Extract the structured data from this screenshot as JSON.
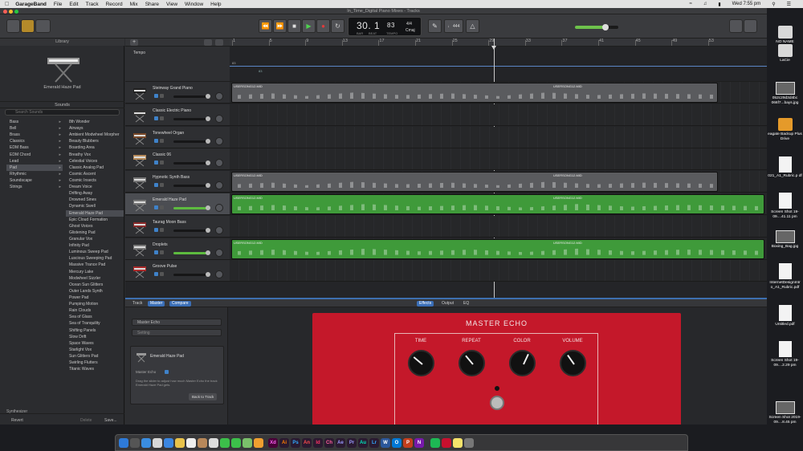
{
  "menubar": {
    "app": "GarageBand",
    "items": [
      "File",
      "Edit",
      "Track",
      "Record",
      "Mix",
      "Share",
      "View",
      "Window",
      "Help"
    ],
    "clock": "Wed 7:55 pm"
  },
  "window": {
    "title": "In_Time_Digital Piano Mixes - Tracks"
  },
  "lcd": {
    "position": "30. 1",
    "bar_lbl": "BAR",
    "beat_lbl": "BEAT",
    "tempo": "83",
    "tempo_lbl": "TEMPO",
    "sig": "4/4",
    "key": "Cmaj",
    "count": "♩ 444"
  },
  "library": {
    "header": "Library",
    "selected_patch": "Emerald Haze Pad",
    "sounds_header": "Sounds",
    "search_placeholder": "Search Sounds",
    "categories": [
      "Bass",
      "Bell",
      "Brass",
      "Classics",
      "EDM Bass",
      "EDM Chord",
      "Lead",
      "Pad",
      "Rhythmic",
      "Soundscape",
      "Strings"
    ],
    "selected_category": 7,
    "sounds": [
      "8th Wonder",
      "Airways",
      "Ambient Modwheel Morpher",
      "Beauty Blubbers",
      "Boarding Area",
      "Breathy Vox",
      "Celestial Voices",
      "Classic Analog Pad",
      "Cosmic Ascent",
      "Cosmic Insects",
      "Dream Voice",
      "Drifting Away",
      "Drowned Sines",
      "Dynamic Swell",
      "Emerald Haze Pad",
      "Epic Cloud Formation",
      "Ghost Voices",
      "Glistening Pad",
      "Granular Vox",
      "Infinity Pad",
      "Luminous Sweep Pad",
      "Luscious Sweeping Pad",
      "Massive Trance Pad",
      "Mercury Lake",
      "Modwheel Sizzler",
      "Ocean Sun Glitters",
      "Outer Lands Synth",
      "Power Pad",
      "Pumping Motion",
      "Rain Clouds",
      "Sea of Glass",
      "Sea of Tranquility",
      "Shifting Panels",
      "Slow Drift",
      "Space Waves",
      "Starlight Vox",
      "Sun Glitters Pad",
      "Swirling Flutters",
      "Titanic Waves"
    ],
    "selected_sound": 14,
    "synthesizer": "Synthesizer",
    "revert": "Revert",
    "delete": "Delete",
    "save": "Save..."
  },
  "ruler": [
    "1",
    "5",
    "9",
    "13",
    "17",
    "21",
    "25",
    "29",
    "33",
    "37",
    "41",
    "45",
    "49",
    "53"
  ],
  "tempo": {
    "label": "Tempo",
    "value": "83",
    "value2": "83"
  },
  "tracks": [
    {
      "name": "Steinway Grand Piano",
      "regions": [
        {
          "label": "USERSONG12.MID",
          "x": 0.0,
          "w": 0.905,
          "kind": "grey"
        }
      ],
      "region2": "USERSONG12.MID"
    },
    {
      "name": "Classic Electric Piano",
      "regions": []
    },
    {
      "name": "Tonewheel Organ",
      "regions": []
    },
    {
      "name": "Classic 06",
      "regions": []
    },
    {
      "name": "Hypnotic Synth Bass",
      "regions": [
        {
          "label": "USERSONG12.MID",
          "kind": "grey"
        }
      ],
      "region2": "USERSONG12.MID"
    },
    {
      "name": "Emerald Haze Pad",
      "regions": [
        {
          "label": "USERSONG12.MID",
          "kind": "green"
        }
      ],
      "region2": "USERSONG12.MID"
    },
    {
      "name": "Taurag Moon Bass",
      "regions": []
    },
    {
      "name": "Droplets",
      "regions": [
        {
          "label": "USERSONG12.MID",
          "kind": "green"
        }
      ],
      "region2": "USERSONG12.MID"
    },
    {
      "name": "Groove Pulse",
      "regions": []
    }
  ],
  "bottom": {
    "tab_track": "Track",
    "tab_master": "Master",
    "tab_compare": "Compare",
    "tab_effects": "Effects",
    "tab_output": "Output",
    "tab_eq": "EQ",
    "preset": "Master Echo",
    "setting": "Setting",
    "patch_name": "Emerald Haze Pad",
    "echo_label": "Master Echo",
    "help": "Drag the slider to adjust how much Master Echo the track Emerald Haze Pad gets.",
    "back": "Back to Track"
  },
  "pedal": {
    "title": "MASTER ECHO",
    "knobs": [
      "TIME",
      "REPEAT",
      "COLOR",
      "VOLUME"
    ],
    "color": "#c4182a"
  },
  "desktop": [
    {
      "label": "NO NAME"
    },
    {
      "label": "LaCie"
    },
    {
      "label": "052c29d3d4bc 066f7...bays.jpg"
    },
    {
      "label": "eagate Backup Plus Drive"
    },
    {
      "label": "021_A1_Rubric.p df"
    },
    {
      "label": "Screen Shot 19-09....41.11 pm"
    },
    {
      "label": "Boxing_Bag.jpg"
    },
    {
      "label": "InternetDesignIntr o_A1_Rubric.pdf"
    },
    {
      "label": "Untitled.pdf"
    },
    {
      "label": "Screen Shot 19-09....2.29 pm"
    },
    {
      "label": "Screen Shot 2019-09....8.45 pm"
    }
  ],
  "dock": [
    "Xd",
    "Ai",
    "Ps",
    "An",
    "Id",
    "Ch",
    "Ae",
    "Pr",
    "Au",
    "Lr",
    "W",
    "O",
    "P",
    "N"
  ]
}
